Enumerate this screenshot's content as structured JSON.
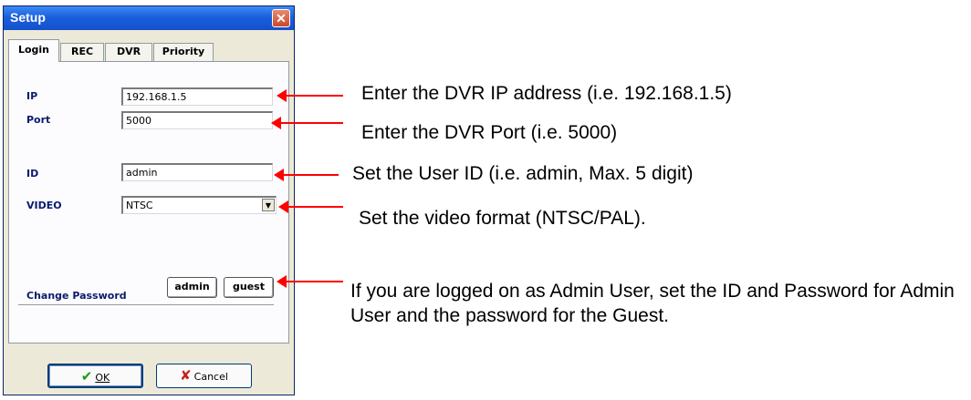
{
  "dialog": {
    "title": "Setup",
    "close_label": "✕",
    "tabs": [
      {
        "label": "Login",
        "active": true
      },
      {
        "label": "REC",
        "active": false
      },
      {
        "label": "DVR",
        "active": false
      },
      {
        "label": "Priority",
        "active": false
      }
    ],
    "fields": {
      "ip": {
        "label": "IP",
        "value": "192.168.1.5"
      },
      "port": {
        "label": "Port",
        "value": "5000"
      },
      "id": {
        "label": "ID",
        "value": "admin"
      },
      "video": {
        "label": "VIDEO",
        "value": "NTSC"
      }
    },
    "change_password": {
      "label": "Change Password",
      "admin_label": "admin",
      "guest_label": "guest"
    },
    "buttons": {
      "ok_label": "OK",
      "cancel_label": "Cancel"
    }
  },
  "annotations": {
    "ip": "Enter the DVR IP address (i.e. 192.168.1.5)",
    "port": "Enter the DVR Port (i.e. 5000)",
    "id": "Set the User ID (i.e. admin, Max. 5 digit)",
    "video": "Set the video format (NTSC/PAL).",
    "password": "If you are logged on as Admin User, set the ID and Password for Admin User and the password for the Guest."
  },
  "colors": {
    "arrow": "#ff0000",
    "title_bar": "#1a5fdc",
    "label_text": "#0a1b6a"
  }
}
